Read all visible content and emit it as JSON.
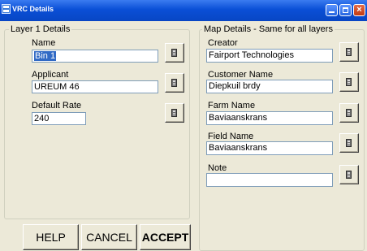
{
  "window": {
    "title": "VRC Details"
  },
  "layer": {
    "group_title": "Layer 1 Details",
    "fields": [
      {
        "label": "Name",
        "value": "Bin 1"
      },
      {
        "label": "Applicant",
        "value": "UREUM 46"
      },
      {
        "label": "Default Rate",
        "value": "240"
      }
    ]
  },
  "map": {
    "group_title": "Map Details - Same for all layers",
    "fields": [
      {
        "label": "Creator",
        "value": "Fairport Technologies"
      },
      {
        "label": "Customer Name",
        "value": "Diepkuil brdy"
      },
      {
        "label": "Farm Name",
        "value": "Baviaanskrans"
      },
      {
        "label": "Field Name",
        "value": "Baviaanskrans"
      },
      {
        "label": "Note",
        "value": ""
      }
    ]
  },
  "buttons": {
    "help": "HELP",
    "cancel": "CANCEL",
    "accept": "ACCEPT"
  },
  "icons": {
    "field_picker": "calculator-icon",
    "app": "window-app-icon"
  },
  "colors": {
    "titlebar": "#0a4fd6",
    "dialog": "#ece9d8",
    "selection": "#316ac5"
  }
}
